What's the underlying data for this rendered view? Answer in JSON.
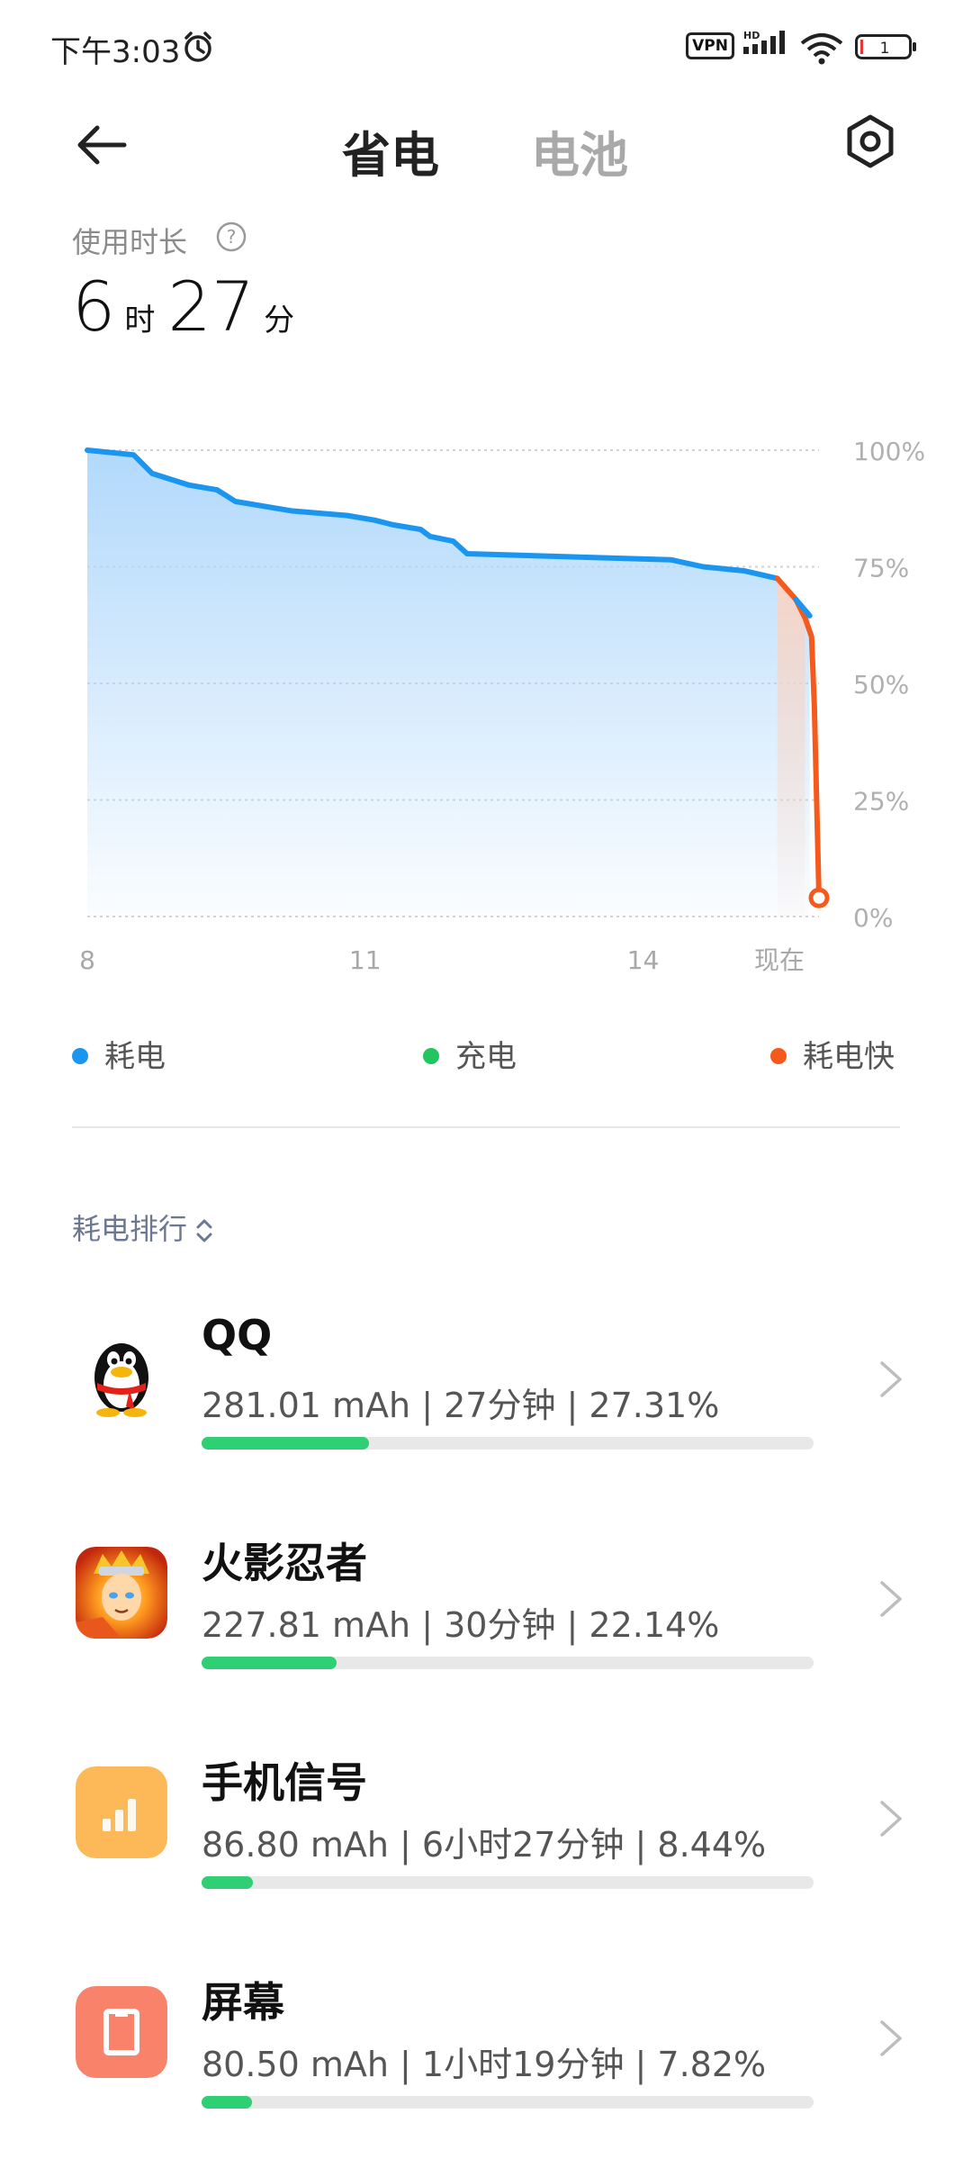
{
  "status_bar": {
    "time": "下午3:03",
    "vpn_label": "VPN",
    "hd_label": "HD",
    "battery_level": "1"
  },
  "header": {
    "tab_power_saving": "省电",
    "tab_battery": "电池"
  },
  "usage": {
    "label": "使用时长",
    "hours": "6",
    "hours_unit": "时",
    "minutes": "27",
    "minutes_unit": "分"
  },
  "chart_data": {
    "type": "line",
    "x_ticks": [
      "8",
      "11",
      "14",
      "现在"
    ],
    "y_ticks": [
      "100%",
      "75%",
      "50%",
      "25%",
      "0%"
    ],
    "ylim": [
      0,
      100
    ],
    "series": [
      {
        "name": "耗电",
        "color": "#1a96f0",
        "points": [
          [
            8.0,
            100
          ],
          [
            8.5,
            99
          ],
          [
            8.7,
            95
          ],
          [
            9.1,
            92.5
          ],
          [
            9.4,
            91.5
          ],
          [
            9.6,
            89
          ],
          [
            10.2,
            87
          ],
          [
            10.8,
            86
          ],
          [
            11.1,
            85
          ],
          [
            11.3,
            84
          ],
          [
            11.6,
            83
          ],
          [
            11.7,
            81.5
          ],
          [
            11.95,
            80.5
          ],
          [
            12.1,
            77.8
          ],
          [
            14.3,
            76.5
          ],
          [
            14.65,
            75
          ],
          [
            15.1,
            74.1
          ],
          [
            15.45,
            72.5
          ]
        ]
      },
      {
        "name": "耗电快",
        "color": "#f55a1c",
        "points": [
          [
            15.45,
            72.5
          ],
          [
            15.65,
            68
          ],
          [
            15.75,
            64
          ],
          [
            15.82,
            60
          ],
          [
            15.85,
            45
          ],
          [
            15.9,
            4
          ]
        ]
      },
      {
        "name": "耗电",
        "color": "#1a96f0",
        "points": [
          [
            15.65,
            68
          ],
          [
            15.8,
            64.5
          ]
        ]
      }
    ],
    "legend": [
      {
        "label": "耗电",
        "color": "#1a96f0"
      },
      {
        "label": "充电",
        "color": "#22c55e"
      },
      {
        "label": "耗电快",
        "color": "#f55a1c"
      }
    ],
    "x_range": [
      8,
      15.9
    ],
    "grid": true
  },
  "ranking": {
    "header": "耗电排行",
    "items": [
      {
        "name": "QQ",
        "stats": "281.01 mAh | 27分钟 | 27.31%",
        "fraction": 0.273
      },
      {
        "name": "火影忍者",
        "stats": "227.81 mAh | 30分钟 | 22.14%",
        "fraction": 0.221
      },
      {
        "name": "手机信号",
        "stats": "86.80 mAh | 6小时27分钟 | 8.44%",
        "fraction": 0.084
      },
      {
        "name": "屏幕",
        "stats": "80.50 mAh | 1小时19分钟 | 7.82%",
        "fraction": 0.082
      }
    ]
  }
}
